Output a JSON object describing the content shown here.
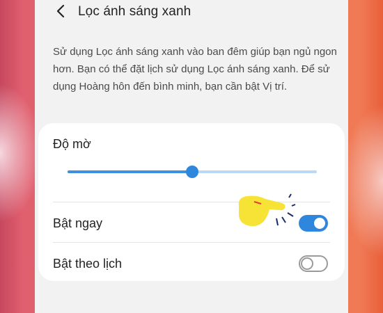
{
  "header": {
    "title": "Lọc ánh sáng xanh",
    "back_icon": "chevron-left-icon"
  },
  "description": "Sử dụng Lọc ánh sáng xanh vào ban đêm giúp bạn ngủ ngon hơn. Bạn có thể đặt lịch sử dụng Lọc ánh sáng xanh. Để sử dụng Hoàng hôn đến bình minh, bạn cần bật Vị trí.",
  "opacity": {
    "label": "Độ mờ",
    "value": 0.5
  },
  "rows": [
    {
      "label": "Bật ngay",
      "toggle_on": true
    },
    {
      "label": "Bật theo lịch",
      "toggle_on": false
    }
  ],
  "colors": {
    "accent": "#2f86dd",
    "card": "#ffffff",
    "screen": "#f2f2f2",
    "pointer_hand": "#f6e335"
  },
  "overlay_icon": "pointing-hand-icon"
}
